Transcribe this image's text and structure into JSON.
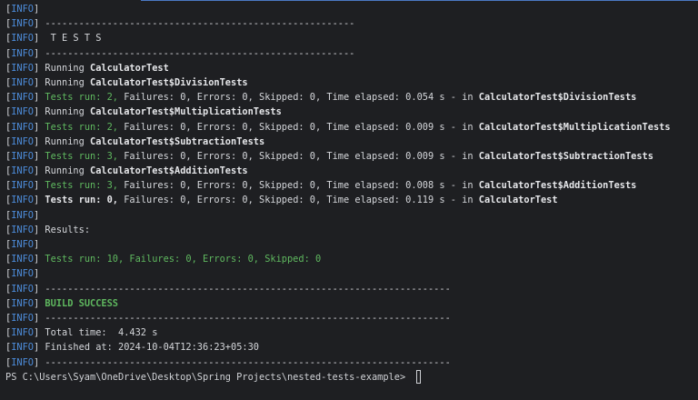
{
  "terminal": {
    "info_tag": "INFO",
    "lines": {
      "l0": "",
      "l1": " -------------------------------------------------------",
      "l2": "  T E S T S",
      "l3": " -------------------------------------------------------",
      "l4_pre": " Running ",
      "l4_cls": "CalculatorTest",
      "l5_pre": " Running ",
      "l5_cls": "CalculatorTest$DivisionTests",
      "l6_a": " Tests run: 2,",
      "l6_b": " Failures: 0, Errors: 0, Skipped: 0, Time elapsed: 0.054 s - in ",
      "l6_cls": "CalculatorTest$DivisionTests",
      "l7_pre": " Running ",
      "l7_cls": "CalculatorTest$MultiplicationTests",
      "l8_a": " Tests run: 2,",
      "l8_b": " Failures: 0, Errors: 0, Skipped: 0, Time elapsed: 0.009 s - in ",
      "l8_cls": "CalculatorTest$MultiplicationTests",
      "l9_pre": " Running ",
      "l9_cls": "CalculatorTest$SubtractionTests",
      "l10_a": " Tests run: 3,",
      "l10_b": " Failures: 0, Errors: 0, Skipped: 0, Time elapsed: 0.009 s - in ",
      "l10_cls": "CalculatorTest$SubtractionTests",
      "l11_pre": " Running ",
      "l11_cls": "CalculatorTest$AdditionTests",
      "l12_a": " Tests run: 3,",
      "l12_b": " Failures: 0, Errors: 0, Skipped: 0, Time elapsed: 0.008 s - in ",
      "l12_cls": "CalculatorTest$AdditionTests",
      "l13_a": " Tests run: 0,",
      "l13_b": " Failures: 0, Errors: 0, Skipped: 0, Time elapsed: 0.119 s - in ",
      "l13_cls": "CalculatorTest",
      "l14": "",
      "l15": " Results:",
      "l16": "",
      "l17": " Tests run: 10, Failures: 0, Errors: 0, Skipped: 0",
      "l18": "",
      "l19": " ------------------------------------------------------------------------",
      "l20": " BUILD SUCCESS",
      "l21": " ------------------------------------------------------------------------",
      "l22": " Total time:  4.432 s",
      "l23": " Finished at: 2024-10-04T12:36:23+05:30",
      "l24": " ------------------------------------------------------------------------"
    },
    "prompt": "PS C:\\Users\\Syam\\OneDrive\\Desktop\\Spring Projects\\nested-tests-example> "
  },
  "colors": {
    "background": "#1e1f22",
    "info_tag": "#4d8ddc",
    "success_green": "#5fb85f",
    "text": "#d4d6da"
  }
}
